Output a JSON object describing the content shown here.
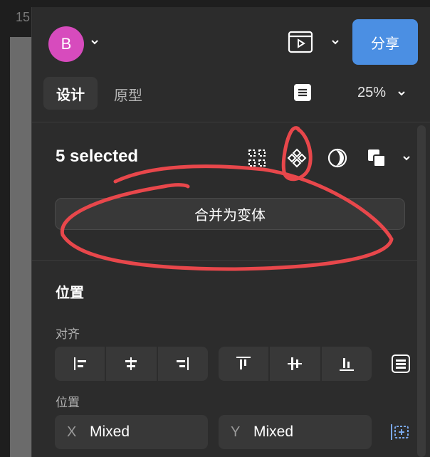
{
  "canvas": {
    "ruler_number": "15"
  },
  "header": {
    "avatar_letter": "B",
    "share_label": "分享",
    "share_color": "#4b8fe3",
    "avatar_color": "#d74bbd",
    "icons": [
      "chevron-down-icon",
      "present-icon"
    ]
  },
  "tabs": [
    {
      "label": "设计",
      "active": true
    },
    {
      "label": "原型",
      "active": false
    }
  ],
  "zoom": "25%",
  "selection": {
    "label": "5 selected",
    "tools": [
      "grid-icon",
      "component-icon",
      "mask-icon",
      "boolean-icon"
    ],
    "combine_label": "合并为变体"
  },
  "position_section": {
    "title": "位置",
    "align_label": "对齐",
    "align_horizontal": [
      "align-left-icon",
      "align-center-h-icon",
      "align-right-icon"
    ],
    "align_vertical": [
      "align-top-icon",
      "align-middle-icon",
      "align-bottom-icon"
    ],
    "position_label": "位置",
    "x": {
      "axis": "X",
      "value": "Mixed"
    },
    "y": {
      "axis": "Y",
      "value": "Mixed"
    }
  },
  "annotation_color": "#e8474b"
}
